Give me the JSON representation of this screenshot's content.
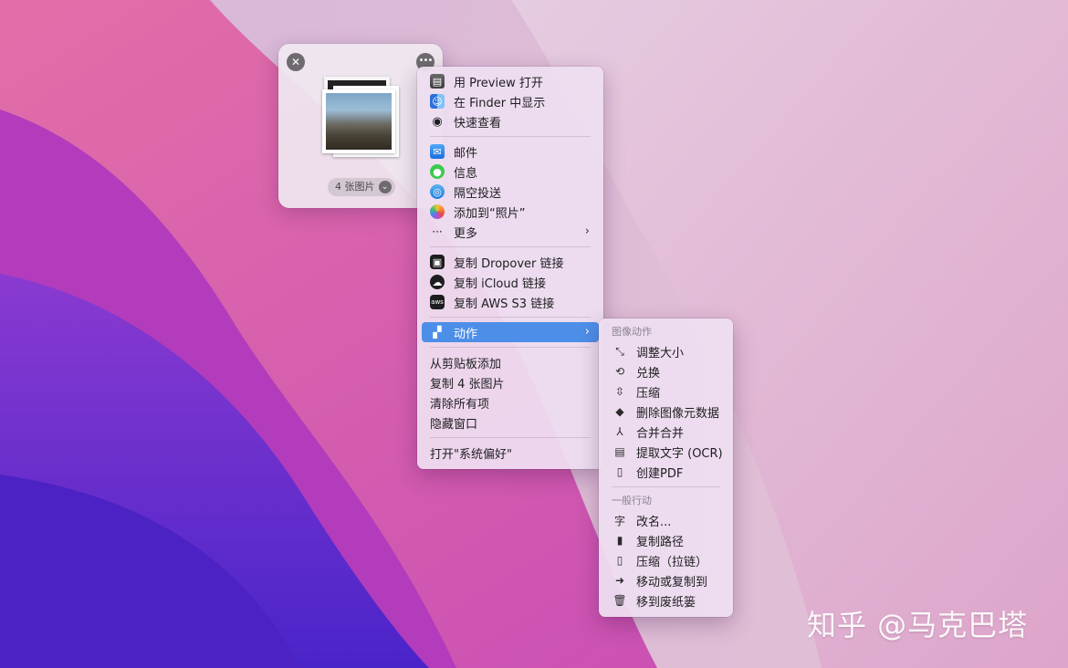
{
  "shelf": {
    "close_icon": "✕",
    "more_icon": "•••",
    "count_label": "4 张图片",
    "chevron_icon": "⌄"
  },
  "main_menu": {
    "groups": [
      [
        {
          "label": "用 Preview 打开",
          "icon": "preview-icon"
        },
        {
          "label": "在 Finder 中显示",
          "icon": "finder-icon"
        },
        {
          "label": "快速查看",
          "icon": "eye-icon"
        }
      ],
      [
        {
          "label": "邮件",
          "icon": "mail-icon"
        },
        {
          "label": "信息",
          "icon": "messages-icon"
        },
        {
          "label": "隔空投送",
          "icon": "airdrop-icon"
        },
        {
          "label": "添加到“照片”",
          "icon": "photos-icon"
        },
        {
          "label": "更多",
          "icon": "ellipsis-icon",
          "submenu": true
        }
      ],
      [
        {
          "label": "复制 Dropover 链接",
          "icon": "dropover-icon"
        },
        {
          "label": "复制 iCloud 链接",
          "icon": "icloud-icon"
        },
        {
          "label": "复制 AWS S3 链接",
          "icon": "aws-icon"
        }
      ],
      [
        {
          "label": "动作",
          "icon": "document-icon",
          "submenu": true,
          "active": true
        }
      ],
      [
        {
          "label": "从剪贴板添加"
        },
        {
          "label": "复制 4 张图片"
        },
        {
          "label": "清除所有项"
        },
        {
          "label": "隐藏窗口"
        }
      ],
      [
        {
          "label": "打开\"系统偏好\""
        }
      ]
    ]
  },
  "sub_menu": {
    "image_heading": "图像动作",
    "image_items": [
      {
        "label": "调整大小",
        "icon": "resize-icon"
      },
      {
        "label": "兑换",
        "icon": "convert-icon"
      },
      {
        "label": "压缩",
        "icon": "compress-icon"
      },
      {
        "label": "删除图像元数据",
        "icon": "erase-metadata-icon"
      },
      {
        "label": "合并合并",
        "icon": "merge-icon"
      },
      {
        "label": "提取文字 (OCR)",
        "icon": "ocr-icon"
      },
      {
        "label": "创建PDF",
        "icon": "pdf-icon"
      }
    ],
    "general_heading": "一般行动",
    "general_items": [
      {
        "label": "改名...",
        "icon": "rename-icon"
      },
      {
        "label": "复制路径",
        "icon": "copy-path-icon"
      },
      {
        "label": "压缩（拉链）",
        "icon": "zip-icon"
      },
      {
        "label": "移动或复制到",
        "icon": "move-icon"
      },
      {
        "label": "移到废纸篓",
        "icon": "trash-icon"
      }
    ]
  },
  "watermark": "知乎 @马克巴塔",
  "colors": {
    "highlight": "#4d8fe8",
    "menu_bg": "#eedef0",
    "wallpaper_base": "#b64bb7"
  }
}
